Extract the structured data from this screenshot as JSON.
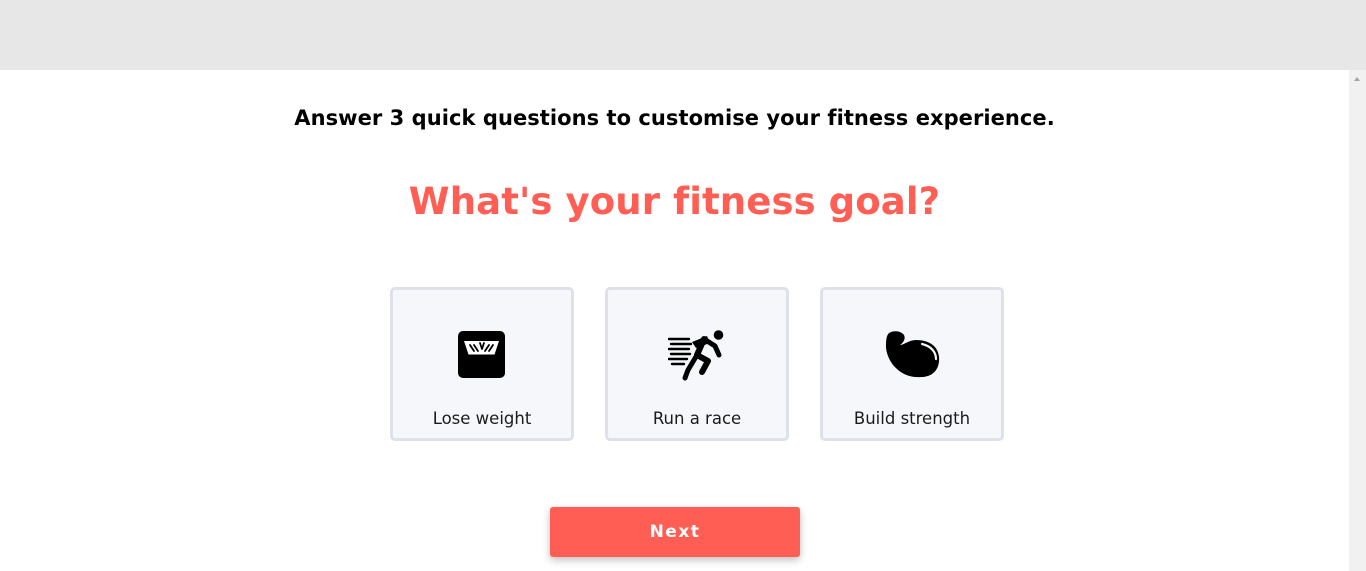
{
  "intro_text": "Answer 3 quick questions to customise your fitness experience.",
  "question": "What's your fitness goal?",
  "options": [
    {
      "label": "Lose weight",
      "icon": "scale-icon"
    },
    {
      "label": "Run a race",
      "icon": "runner-icon"
    },
    {
      "label": "Build strength",
      "icon": "flexed-arm-icon"
    }
  ],
  "next_label": "Next",
  "colors": {
    "accent": "#ff5e54",
    "card_background": "#f6f7fb",
    "card_border": "#dfe1ea",
    "top_bar": "#e7e7e7"
  }
}
